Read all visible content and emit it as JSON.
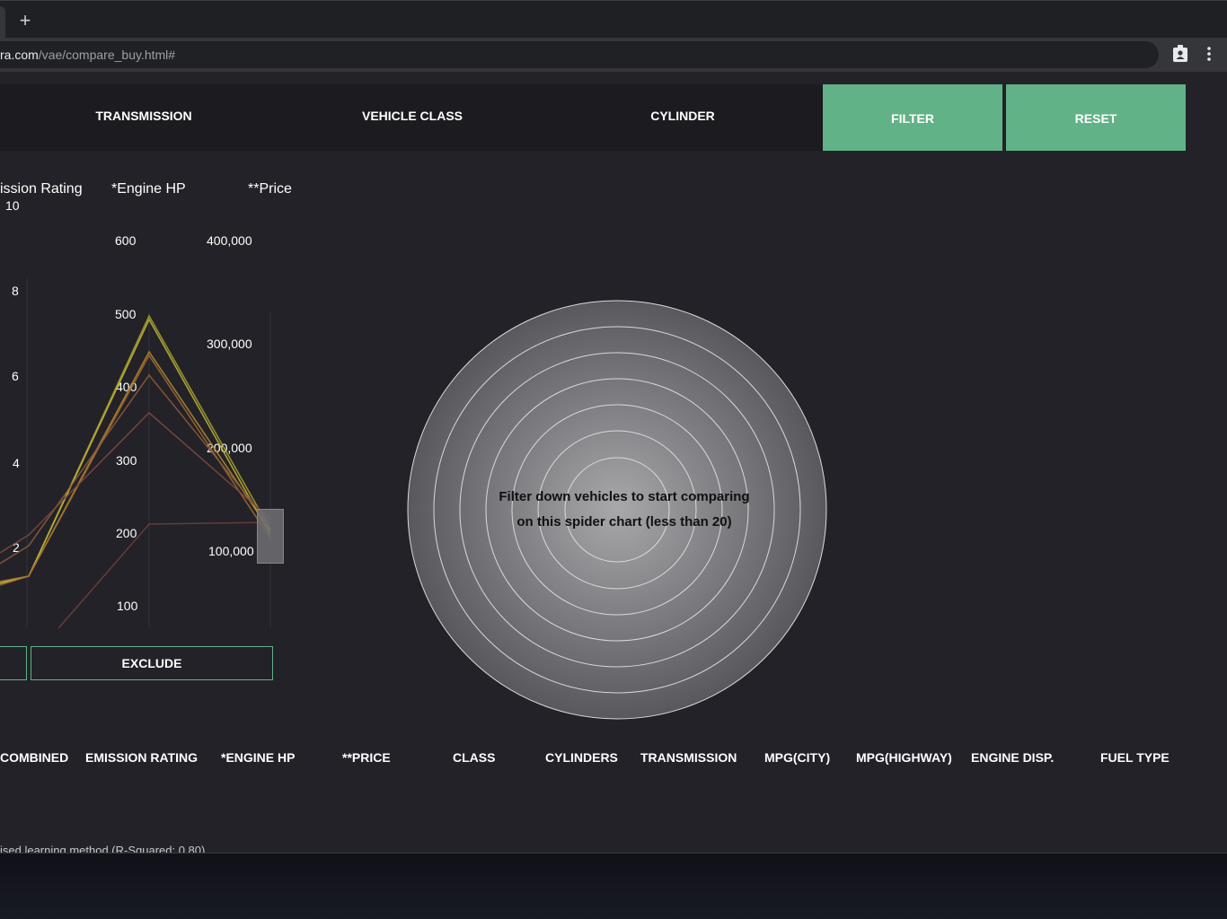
{
  "browser": {
    "new_tab_glyph": "+",
    "url_host": "ra.com",
    "url_path": "/vae/compare_buy.html#",
    "icons": [
      "plus-icon",
      "profile-badge-icon",
      "kebab-menu-icon"
    ]
  },
  "nav": {
    "items": [
      "TRANSMISSION",
      "VEHICLE CLASS",
      "CYLINDER"
    ],
    "filter_label": "FILTER",
    "reset_label": "RESET",
    "accent": "#62b287"
  },
  "parallel": {
    "axes": [
      {
        "label": "ission Rating",
        "ticks": [
          "10",
          "8",
          "6",
          "4",
          "2"
        ]
      },
      {
        "label": "*Engine HP",
        "ticks": [
          "600",
          "500",
          "400",
          "300",
          "200",
          "100"
        ]
      },
      {
        "label": "**Price",
        "ticks": [
          "400,000",
          "300,000",
          "200,000",
          "100,000"
        ]
      }
    ],
    "exclude_label": "EXCLUDE",
    "line_colors": [
      "#a9a22a",
      "#c4b83a",
      "#b9892f",
      "#a06a35",
      "#8d5a3a",
      "#7e4a3f",
      "#6e3f3a"
    ]
  },
  "spider": {
    "message_line1": "Filter down vehicles to start comparing",
    "message_line2": "on this spider chart (less than 20)"
  },
  "table": {
    "columns": [
      "COMBINED",
      "EMISSION RATING",
      "*ENGINE HP",
      "**PRICE",
      "CLASS",
      "CYLINDERS",
      "TRANSMISSION",
      "MPG(CITY)",
      "MPG(HIGHWAY)",
      "ENGINE DISP.",
      "FUEL TYPE"
    ]
  },
  "footnote": "ised learning method (R-Squared: 0.80)"
}
